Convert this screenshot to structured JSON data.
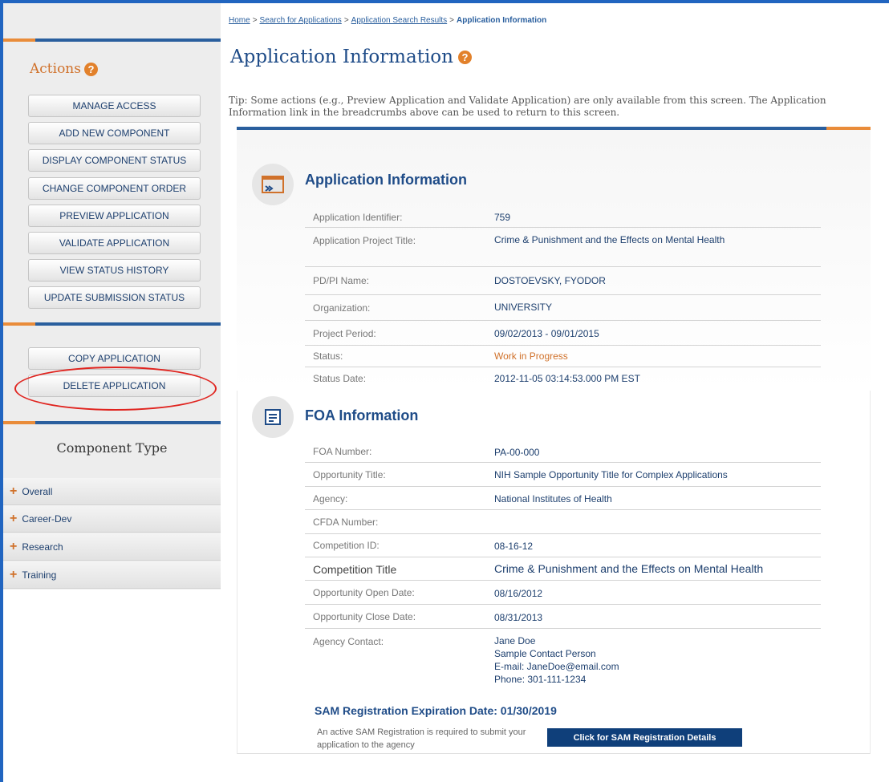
{
  "breadcrumb": {
    "items": [
      "Home",
      "Search for Applications",
      "Application Search Results"
    ],
    "current": "Application Information",
    "separator": ">"
  },
  "sidebar": {
    "actions_title": "Actions",
    "help_glyph": "?",
    "action_buttons": [
      "MANAGE ACCESS",
      "ADD NEW COMPONENT",
      "DISPLAY COMPONENT STATUS",
      "CHANGE COMPONENT ORDER",
      "PREVIEW APPLICATION",
      "VALIDATE APPLICATION",
      "VIEW STATUS HISTORY",
      "UPDATE SUBMISSION STATUS"
    ],
    "secondary_buttons": [
      "COPY APPLICATION",
      "DELETE APPLICATION"
    ],
    "component_type_title": "Component Type",
    "component_types": [
      "Overall",
      "Career-Dev",
      "Research",
      "Training"
    ],
    "plus_glyph": "+"
  },
  "main": {
    "title": "Application Information",
    "tip": "Tip: Some actions (e.g., Preview Application and Validate Application) are only available from this screen. The Application Information link in the breadcrumbs above can be used to return to this screen.",
    "application_info": {
      "title": "Application Information",
      "icon": "application-window-icon",
      "rows": [
        {
          "label": "Application Identifier:",
          "value": "759"
        },
        {
          "label": "Application Project Title:",
          "value": "Crime & Punishment and the Effects on Mental Health"
        },
        {
          "label": "PD/PI Name:",
          "value": "DOSTOEVSKY, FYODOR"
        },
        {
          "label": "Organization:",
          "value": "UNIVERSITY"
        },
        {
          "label": "Project Period:",
          "value": "09/02/2013 - 09/01/2015"
        },
        {
          "label": "Status:",
          "value": "Work in Progress"
        },
        {
          "label": "Status Date:",
          "value": "2012-11-05 03:14:53.000 PM EST"
        }
      ]
    },
    "foa_info": {
      "title": "FOA Information",
      "icon": "document-list-icon",
      "rows": [
        {
          "label": "FOA Number:",
          "value": "PA-00-000"
        },
        {
          "label": "Opportunity Title:",
          "value": "NIH Sample Opportunity Title for Complex Applications"
        },
        {
          "label": "Agency:",
          "value": "National Institutes of Health"
        },
        {
          "label": "CFDA Number:",
          "value": ""
        },
        {
          "label": "Competition ID:",
          "value": "08-16-12"
        },
        {
          "label": "Competition Title",
          "value": "Crime & Punishment and the Effects on Mental Health"
        },
        {
          "label": "Opportunity Open Date:",
          "value": "08/16/2012"
        },
        {
          "label": "Opportunity Close Date:",
          "value": "08/31/2013"
        }
      ],
      "agency_contact": {
        "label": "Agency Contact:",
        "name": "Jane Doe",
        "role": "Sample Contact Person",
        "email": "E-mail: JaneDoe@email.com",
        "phone": "Phone: 301-111-1234"
      }
    },
    "sam": {
      "title": "SAM Registration Expiration Date: 01/30/2019",
      "note": "An active SAM Registration is required to submit your application to the agency",
      "button": "Click for SAM Registration Details"
    }
  },
  "colors": {
    "frame_blue": "#2165c0",
    "heading_blue": "#1f4c88",
    "accent_orange": "#d0712a",
    "highlight_red": "#e0241f",
    "button_navy": "#0f3f7a"
  }
}
